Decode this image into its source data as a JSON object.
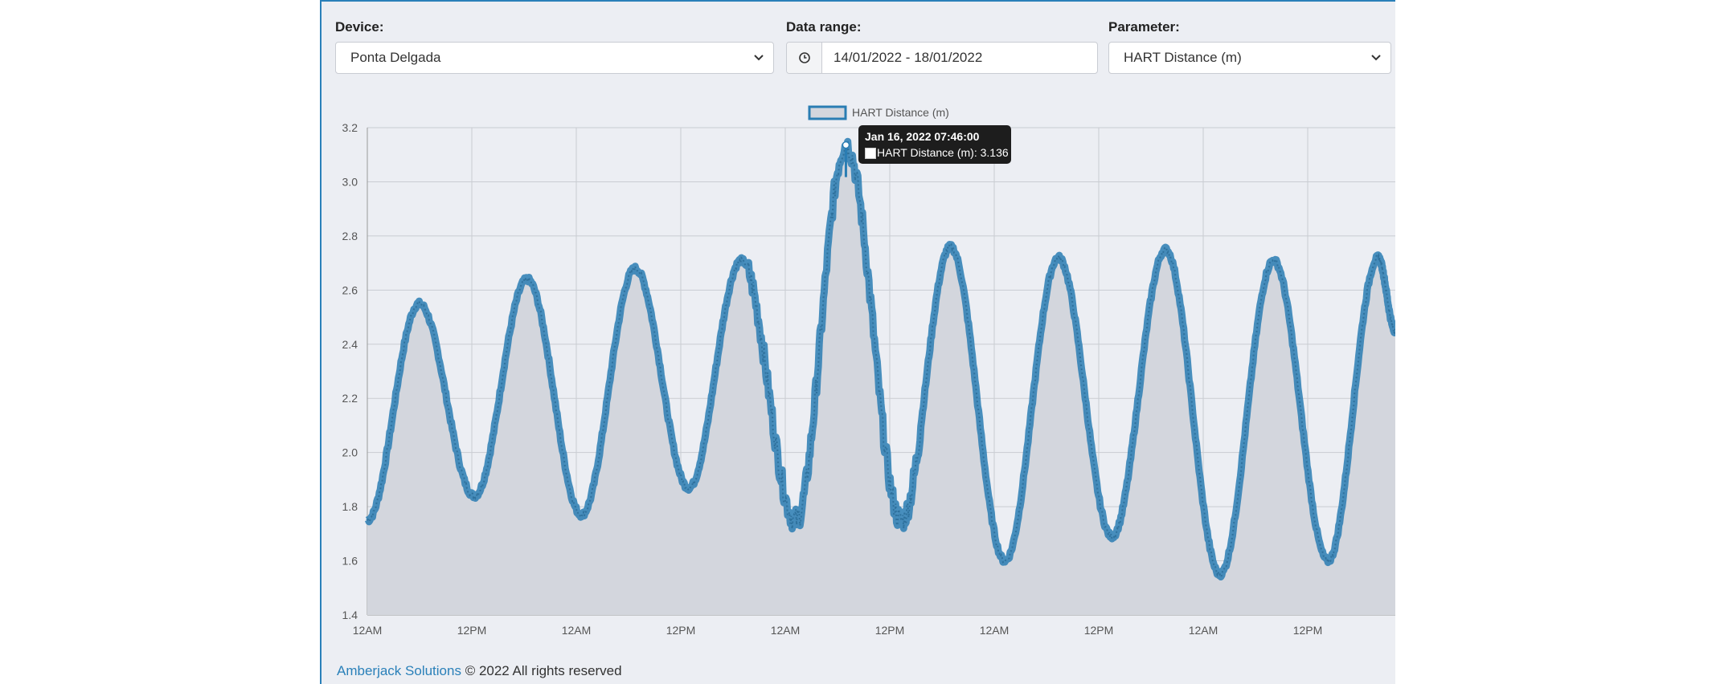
{
  "filters": {
    "device": {
      "label": "Device:",
      "value": "Ponta Delgada"
    },
    "date_range": {
      "label": "Data range:",
      "value": "14/01/2022 - 18/01/2022"
    },
    "parameter": {
      "label": "Parameter:",
      "value": "HART Distance (m)"
    }
  },
  "tooltip": {
    "title": "Jan 16, 2022 07:46:00",
    "series": "HART Distance (m)",
    "value": "3.136",
    "body": "HART Distance (m): 3.136"
  },
  "footer": {
    "brand": "Amberjack Solutions",
    "text": " © 2022 All rights reserved"
  },
  "colors": {
    "line": "#2a7db3",
    "fill": "#d3d6dd",
    "grid": "#c9ccd2",
    "accent": "#2a80b9"
  },
  "chart_data": {
    "type": "area",
    "legend": "HART Distance (m)",
    "legend_position": "top-center",
    "grid": true,
    "ylim": [
      1.4,
      3.2
    ],
    "yticks": [
      "1.4",
      "1.6",
      "1.8",
      "2.0",
      "2.2",
      "2.4",
      "2.6",
      "2.8",
      "3.0",
      "3.2"
    ],
    "xticks": [
      "12AM",
      "12PM",
      "12AM",
      "12PM",
      "12AM",
      "12PM",
      "12AM",
      "12PM",
      "12AM",
      "12PM"
    ],
    "x_unit": "hours since 14/01/2022 12AM",
    "xlim": [
      0,
      119
    ],
    "series": [
      {
        "name": "HART Distance (m)",
        "x": [
          0,
          6,
          12.4,
          18.5,
          24.8,
          31,
          37.2,
          43.3,
          49.6,
          55.4,
          61.8,
          67.5,
          73.8,
          80,
          86.2,
          92.4,
          98.7,
          104.9,
          111.2,
          117,
          119
        ],
        "values": [
          1.75,
          2.55,
          1.84,
          2.64,
          1.77,
          2.68,
          1.87,
          2.71,
          1.75,
          3.136,
          1.75,
          2.76,
          1.6,
          2.72,
          1.69,
          2.75,
          1.55,
          2.71,
          1.6,
          2.72,
          2.45
        ]
      }
    ],
    "highlight": {
      "x": 55.4,
      "value": 3.136
    }
  }
}
